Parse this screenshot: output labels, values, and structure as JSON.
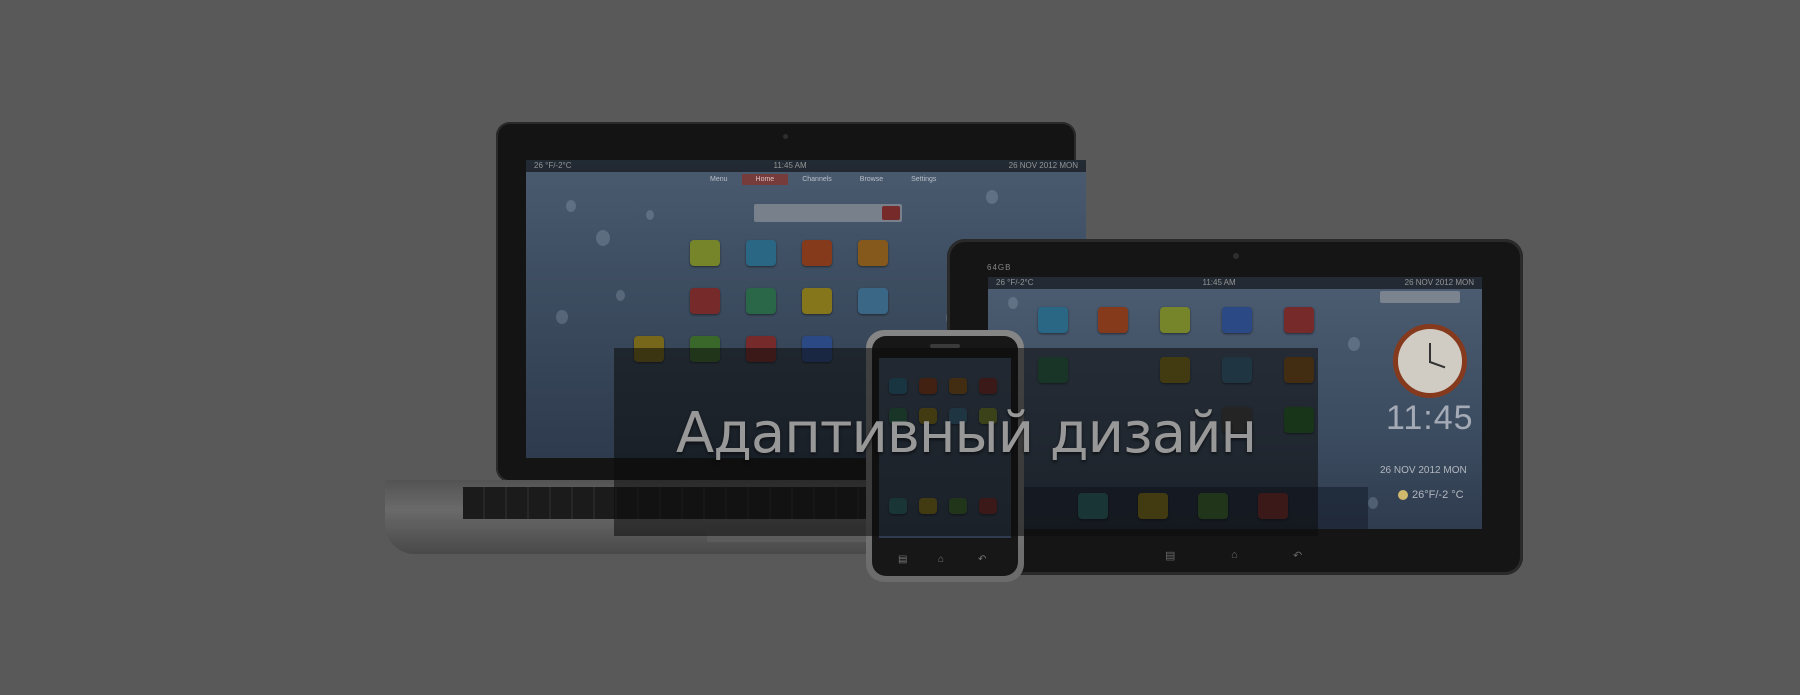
{
  "banner": {
    "title": "Адаптивный дизайн"
  },
  "laptop": {
    "status_left": "26 °F/-2°C",
    "status_center": "11:45 AM",
    "status_right": "26 NOV 2012 MON",
    "menu": [
      "Menu",
      "Home",
      "Channels",
      "Browse",
      "Settings"
    ],
    "active_menu": "Home"
  },
  "tablet": {
    "brand": "64GB",
    "status_left": "26 °F/-2°C",
    "status_center": "11:45 AM",
    "status_right": "26 NOV 2012 MON",
    "time": "11:45",
    "date": "26 NOV 2012 MON",
    "temperature": "26°F/-2 °C"
  },
  "colors": {
    "background": "#5b5b5b",
    "banner_overlay": "rgba(10,10,10,0.55)",
    "title_text": "#9e9e9e"
  }
}
